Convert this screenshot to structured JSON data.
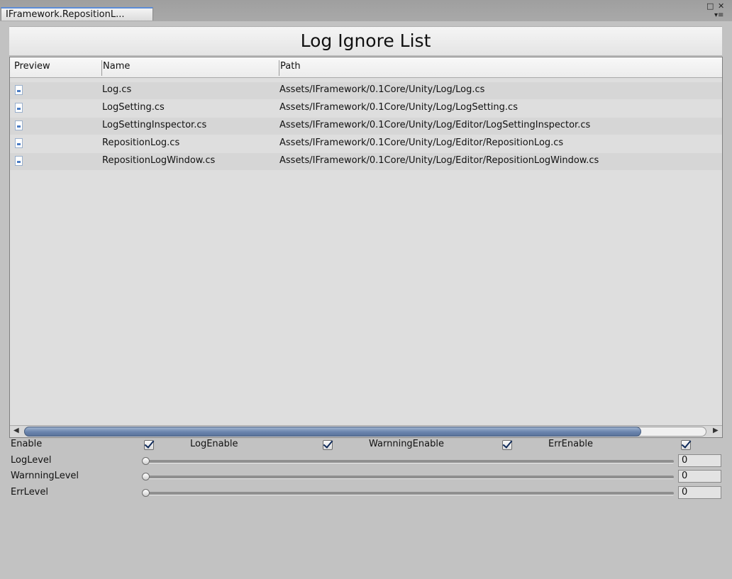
{
  "window": {
    "tab_title": "IFramework.RepositionL...",
    "maximize_glyph": "□",
    "close_glyph": "✕",
    "menu_glyph": "▾≡"
  },
  "header": {
    "title": "Log Ignore List"
  },
  "table": {
    "columns": [
      "Preview",
      "Name",
      "Path"
    ],
    "rows": [
      {
        "icon": "cs-file-icon",
        "name": "Log.cs",
        "path": "Assets/IFramework/0.1Core/Unity/Log/Log.cs"
      },
      {
        "icon": "cs-file-icon",
        "name": "LogSetting.cs",
        "path": "Assets/IFramework/0.1Core/Unity/Log/LogSetting.cs"
      },
      {
        "icon": "cs-file-icon",
        "name": "LogSettingInspector.cs",
        "path": "Assets/IFramework/0.1Core/Unity/Log/Editor/LogSettingInspector.cs"
      },
      {
        "icon": "cs-file-icon",
        "name": "RepositionLog.cs",
        "path": "Assets/IFramework/0.1Core/Unity/Log/Editor/RepositionLog.cs"
      },
      {
        "icon": "cs-file-icon",
        "name": "RepositionLogWindow.cs",
        "path": "Assets/IFramework/0.1Core/Unity/Log/Editor/RepositionLogWindow.cs"
      }
    ],
    "scroll_left_glyph": "◀",
    "scroll_right_glyph": "▶"
  },
  "settings": {
    "toggles": [
      {
        "label": "Enable",
        "checked": true
      },
      {
        "label": "LogEnable",
        "checked": true
      },
      {
        "label": "WarnningEnable",
        "checked": true
      },
      {
        "label": "ErrEnable",
        "checked": true
      }
    ],
    "sliders": [
      {
        "label": "LogLevel",
        "value": "0"
      },
      {
        "label": "WarnningLevel",
        "value": "0"
      },
      {
        "label": "ErrLevel",
        "value": "0"
      }
    ]
  }
}
